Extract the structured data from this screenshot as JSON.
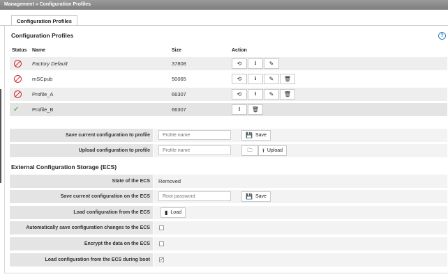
{
  "header": {
    "breadcrumb": "Management  »  Configuration Profiles"
  },
  "tabs": [
    {
      "label": "Configuration Profiles"
    }
  ],
  "profiles_section": {
    "title": "Configuration Profiles",
    "columns": {
      "status": "Status",
      "name": "Name",
      "size": "Size",
      "action": "Action"
    },
    "rows": [
      {
        "status": "disabled",
        "name": "Factory Default",
        "size": "37808",
        "actions": [
          "restore-icon",
          "download-icon",
          "edit-icon"
        ]
      },
      {
        "status": "disabled",
        "name": "mSCpub",
        "size": "50065",
        "actions": [
          "restore-icon",
          "download-icon",
          "edit-icon",
          "delete-icon"
        ]
      },
      {
        "status": "disabled",
        "name": "Profile_A",
        "size": "66307",
        "actions": [
          "restore-icon",
          "download-icon",
          "edit-icon",
          "delete-icon"
        ]
      },
      {
        "status": "active",
        "name": "Profile_B",
        "size": "66307",
        "actions": [
          "download-icon",
          "delete-icon"
        ]
      }
    ]
  },
  "save_profile": {
    "label": "Save current configuration to profile",
    "placeholder": "Profile name",
    "button": "Save"
  },
  "upload_profile": {
    "label": "Upload configuration to profile",
    "placeholder": "Profile name",
    "button": "Upload"
  },
  "ecs_section": {
    "title": "External Configuration Storage (ECS)",
    "state": {
      "label": "State of the ECS",
      "value": "Removed"
    },
    "save": {
      "label": "Save current configuration on the ECS",
      "placeholder": "Root password",
      "button": "Save"
    },
    "load": {
      "label": "Load configuration from the ECS",
      "button": "Load"
    },
    "auto_save": {
      "label": "Automatically save configuration changes to the ECS",
      "checked": false
    },
    "encrypt": {
      "label": "Encrypt the data on the ECS",
      "checked": false
    },
    "load_boot": {
      "label": "Load configuration from the ECS during boot",
      "checked": true
    }
  },
  "colors": {
    "accent": "#2a7bbf",
    "error": "#d12a2a",
    "ok": "#3b9a2e"
  }
}
